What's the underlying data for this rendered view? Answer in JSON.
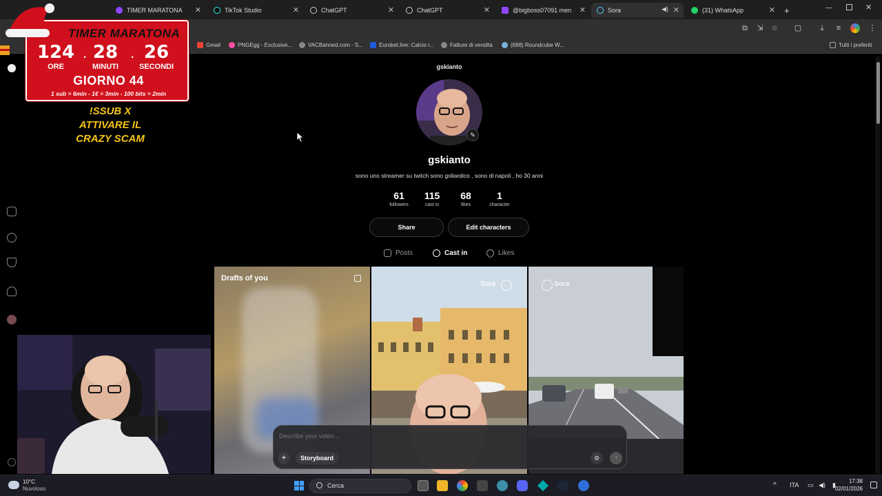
{
  "browser": {
    "tabs": [
      {
        "label": "TIMER MARATONA",
        "icon_color": "#9146ff"
      },
      {
        "label": "TikTok Studio",
        "icon_color": "#25f4ee"
      },
      {
        "label": "ChatGPT",
        "icon_color": "#cccccc"
      },
      {
        "label": "ChatGPT",
        "icon_color": "#cccccc"
      },
      {
        "label": "@bigboss07091 men",
        "icon_color": "#9146ff"
      },
      {
        "label": "Sora",
        "icon_color": "#5ec8ff"
      },
      {
        "label": "(31) WhatsApp",
        "icon_color": "#25d366"
      }
    ],
    "new_tab": "+",
    "bookmarks": [
      {
        "label": "Gmail",
        "color": "#ea4335"
      },
      {
        "label": "PNGEgg - Exclusive...",
        "color": "#ff4fa3"
      },
      {
        "label": "VACBanned.com - S...",
        "color": "#888888"
      },
      {
        "label": "Eurobet.live: Calcio r...",
        "color": "#1e5bd7"
      },
      {
        "label": "Fatture di vendita",
        "color": "#888888"
      },
      {
        "label": "(688) Roundcube W...",
        "color": "#7ab4e0"
      }
    ],
    "bookmarks_all": "Tutti i preferiti"
  },
  "overlay": {
    "timer_title": "TIMER MARATONA",
    "hours": "124",
    "minutes": "28",
    "seconds": "26",
    "hours_label": "ORE",
    "minutes_label": "MINUTI",
    "seconds_label": "SECONDI",
    "day": "GIORNO 44",
    "rates": "1 sub = 6min - 1€ = 3min - 100 bits = 2min",
    "promo_line1": "!SSUB X",
    "promo_line2": "ATTIVARE IL",
    "promo_line3": "CRAZY SCAM"
  },
  "profile": {
    "top_username": "gskianto",
    "handle": "gskianto",
    "bio": "sono uno streamer su twitch sono goliardico , sono di napoli , ho 30 anni",
    "stats": [
      {
        "value": "61",
        "label": "followers"
      },
      {
        "value": "115",
        "label": "cast in"
      },
      {
        "value": "68",
        "label": "likes"
      },
      {
        "value": "1",
        "label": "character"
      }
    ],
    "share_label": "Share",
    "edit_characters_label": "Edit characters",
    "tabs": [
      {
        "label": "Posts",
        "active": false
      },
      {
        "label": "Cast in",
        "active": true
      },
      {
        "label": "Likes",
        "active": false
      }
    ]
  },
  "grid": {
    "drafts_label": "Drafts of you",
    "watermark": "Sora"
  },
  "composer": {
    "placeholder": "Describe your video...",
    "add_label": "+",
    "storyboard_label": "Storyboard"
  },
  "taskbar": {
    "weather_temp": "10°C",
    "weather_desc": "Nuvoloso",
    "search_label": "Cerca",
    "language": "ITA",
    "time": "17:38",
    "date": "02/01/2026"
  }
}
